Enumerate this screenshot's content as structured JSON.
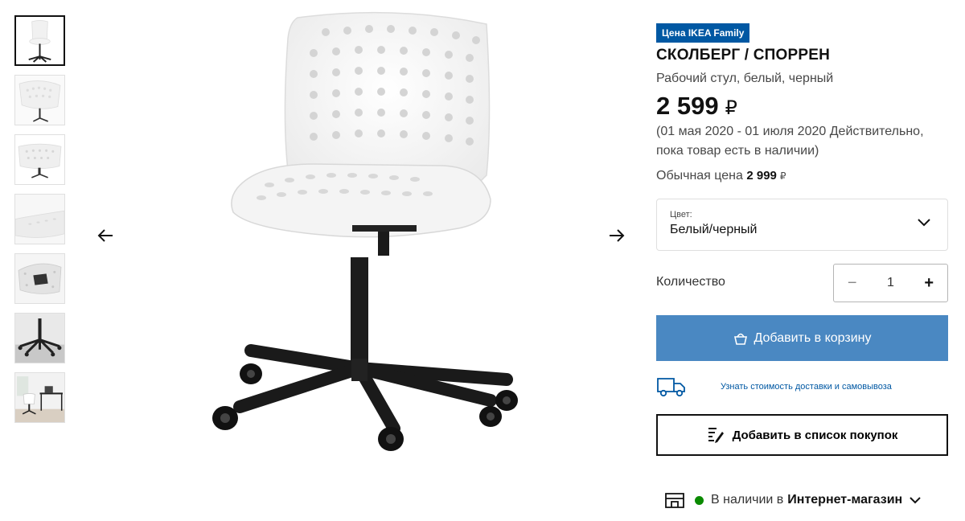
{
  "thumbnails": [
    {
      "alt": "chair-front"
    },
    {
      "alt": "chair-seat-closeup"
    },
    {
      "alt": "chair-back-closeup"
    },
    {
      "alt": "chair-seat-edge"
    },
    {
      "alt": "chair-underside"
    },
    {
      "alt": "chair-base"
    },
    {
      "alt": "chair-room"
    }
  ],
  "product": {
    "badge": "Цена IKEA Family",
    "title": "СКОЛБЕРГ / СПОРРЕН",
    "subtitle": "Рабочий стул, белый, черный",
    "price": "2 599",
    "currency_glyph": "₽",
    "validity": "(01 мая 2020 - 01 июля 2020 Действительно, пока товар есть в наличии)",
    "regular_label": "Обычная цена",
    "regular_price": "2 999"
  },
  "color_select": {
    "label": "Цвет:",
    "value": "Белый/черный"
  },
  "quantity": {
    "label": "Количество",
    "value": "1",
    "minus": "−",
    "plus": "+"
  },
  "actions": {
    "add_to_cart": "Добавить в корзину",
    "delivery_link": "Узнать стоимость доставки и самовывоза",
    "add_to_list": "Добавить в список покупок"
  },
  "stock": {
    "text": "В наличии в",
    "store": "Интернет-магазин"
  },
  "colors": {
    "accent": "#0058a3",
    "cart_button": "#4a88c2",
    "in_stock": "#0a8a00"
  },
  "icons": {
    "prev": "arrow-left-icon",
    "next": "arrow-right-icon",
    "chevron": "chevron-down-icon",
    "bag": "shopping-bag-icon",
    "truck": "delivery-truck-icon",
    "list": "shopping-list-icon",
    "store": "store-icon"
  }
}
